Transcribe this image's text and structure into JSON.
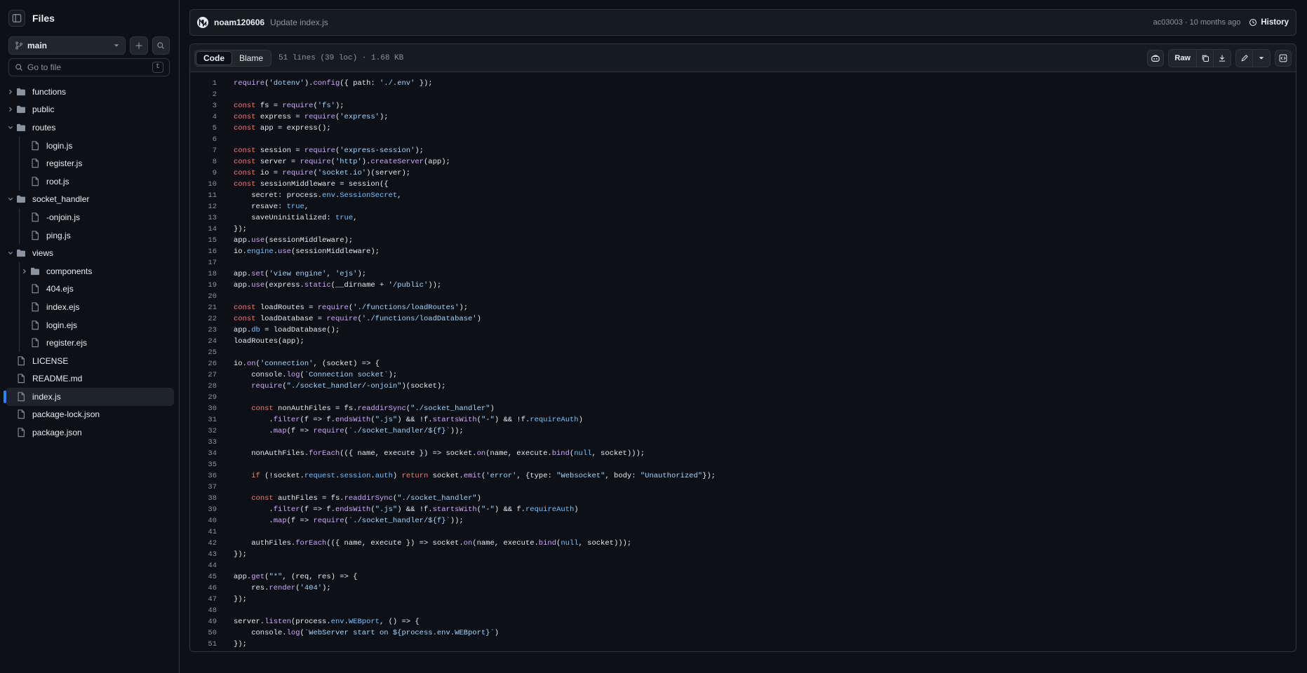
{
  "sidebar": {
    "title": "Files",
    "branch": "main",
    "search_placeholder": "Go to file",
    "search_shortcut": "t",
    "tree": [
      {
        "label": "functions",
        "type": "folder",
        "depth": 0,
        "expanded": false
      },
      {
        "label": "public",
        "type": "folder",
        "depth": 0,
        "expanded": false
      },
      {
        "label": "routes",
        "type": "folder",
        "depth": 0,
        "expanded": true
      },
      {
        "label": "login.js",
        "type": "file",
        "depth": 1
      },
      {
        "label": "register.js",
        "type": "file",
        "depth": 1
      },
      {
        "label": "root.js",
        "type": "file",
        "depth": 1
      },
      {
        "label": "socket_handler",
        "type": "folder",
        "depth": 0,
        "expanded": true
      },
      {
        "label": "-onjoin.js",
        "type": "file",
        "depth": 1
      },
      {
        "label": "ping.js",
        "type": "file",
        "depth": 1
      },
      {
        "label": "views",
        "type": "folder",
        "depth": 0,
        "expanded": true
      },
      {
        "label": "components",
        "type": "folder",
        "depth": 1,
        "expanded": false
      },
      {
        "label": "404.ejs",
        "type": "file",
        "depth": 1
      },
      {
        "label": "index.ejs",
        "type": "file",
        "depth": 1
      },
      {
        "label": "login.ejs",
        "type": "file",
        "depth": 1
      },
      {
        "label": "register.ejs",
        "type": "file",
        "depth": 1
      },
      {
        "label": "LICENSE",
        "type": "file",
        "depth": 0
      },
      {
        "label": "README.md",
        "type": "file",
        "depth": 0
      },
      {
        "label": "index.js",
        "type": "file",
        "depth": 0,
        "active": true
      },
      {
        "label": "package-lock.json",
        "type": "file",
        "depth": 0
      },
      {
        "label": "package.json",
        "type": "file",
        "depth": 0
      }
    ]
  },
  "commit": {
    "author": "noam120606",
    "message": "Update index.js",
    "meta": "ac03003 · 10 months ago",
    "history_label": "History"
  },
  "file": {
    "tab_code": "Code",
    "tab_blame": "Blame",
    "info": "51 lines (39 loc) · 1.68 KB",
    "raw_label": "Raw",
    "lines": [
      "require('dotenv').config({ path: './.env' });",
      "",
      "const fs = require('fs');",
      "const express = require('express');",
      "const app = express();",
      "",
      "const session = require('express-session');",
      "const server = require('http').createServer(app);",
      "const io = require('socket.io')(server);",
      "const sessionMiddleware = session({",
      "    secret: process.env.SessionSecret,",
      "    resave: true,",
      "    saveUninitialized: true,",
      "});",
      "app.use(sessionMiddleware);",
      "io.engine.use(sessionMiddleware);",
      "",
      "app.set('view engine', 'ejs');",
      "app.use(express.static(__dirname + '/public'));",
      "",
      "const loadRoutes = require('./functions/loadRoutes');",
      "const loadDatabase = require('./functions/loadDatabase')",
      "app.db = loadDatabase();",
      "loadRoutes(app);",
      "",
      "io.on('connection', (socket) => {",
      "    console.log(`Connection socket`);",
      "    require(\"./socket_handler/-onjoin\")(socket);",
      "",
      "    const nonAuthFiles = fs.readdirSync(\"./socket_handler\")",
      "        .filter(f => f.endsWith(\".js\") && !f.startsWith(\"-\") && !f.requireAuth)",
      "        .map(f => require(`./socket_handler/${f}`));",
      "",
      "    nonAuthFiles.forEach(({ name, execute }) => socket.on(name, execute.bind(null, socket)));",
      "",
      "    if (!socket.request.session.auth) return socket.emit('error', {type: \"Websocket\", body: \"Unauthorized\"});",
      "",
      "    const authFiles = fs.readdirSync(\"./socket_handler\")",
      "        .filter(f => f.endsWith(\".js\") && !f.startsWith(\"-\") && f.requireAuth)",
      "        .map(f => require(`./socket_handler/${f}`));",
      "",
      "    authFiles.forEach(({ name, execute }) => socket.on(name, execute.bind(null, socket)));",
      "});",
      "",
      "app.get(\"*\", (req, res) => {",
      "    res.render('404');",
      "});",
      "",
      "server.listen(process.env.WEBport, () => {",
      "    console.log(`WebServer start on ${process.env.WEBport}`)",
      "});"
    ]
  }
}
